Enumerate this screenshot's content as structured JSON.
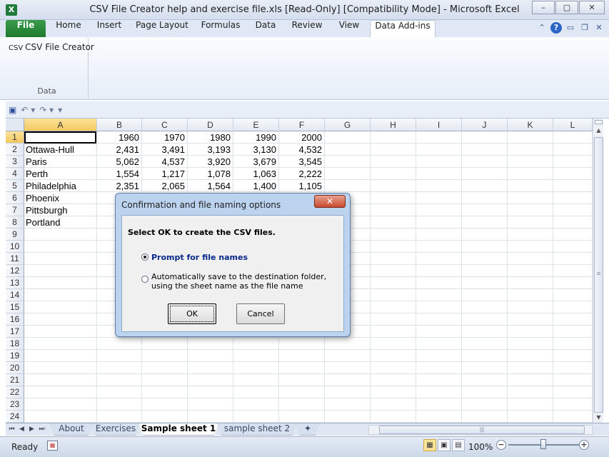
{
  "window": {
    "title": "CSV File Creator help and exercise file.xls  [Read-Only]  [Compatibility Mode]  -  Microsoft Excel",
    "app_icon": "X",
    "controls": [
      "–",
      "▢",
      "✕"
    ]
  },
  "ribbon_tabs": [
    "File",
    "Home",
    "Insert",
    "Page Layout",
    "Formulas",
    "Data",
    "Review",
    "View",
    "Data Add-ins"
  ],
  "active_tab": "Data Add-ins",
  "ribbon": {
    "csv_icon_text": "CSV",
    "csv_button_label": "CSV File Creator",
    "group_label": "Data"
  },
  "grid": {
    "columns": [
      "A",
      "B",
      "C",
      "D",
      "E",
      "F",
      "G",
      "H",
      "I",
      "J",
      "K",
      "L"
    ],
    "selected_column": "A",
    "selected_row": 1,
    "rows": [
      {
        "n": "1",
        "a": "",
        "vals": [
          "1960",
          "1970",
          "1980",
          "1990",
          "2000"
        ]
      },
      {
        "n": "2",
        "a": "Ottawa-Hull",
        "vals": [
          "2,431",
          "3,491",
          "3,193",
          "3,130",
          "4,532"
        ]
      },
      {
        "n": "3",
        "a": "Paris",
        "vals": [
          "5,062",
          "4,537",
          "3,920",
          "3,679",
          "3,545"
        ]
      },
      {
        "n": "4",
        "a": "Perth",
        "vals": [
          "1,554",
          "1,217",
          "1,078",
          "1,063",
          "2,222"
        ]
      },
      {
        "n": "5",
        "a": "Philadelphia",
        "vals": [
          "2,351",
          "2,065",
          "1,564",
          "1,400",
          "1,105"
        ]
      },
      {
        "n": "6",
        "a": "Phoenix",
        "vals": [
          "",
          "",
          "",
          "",
          ""
        ]
      },
      {
        "n": "7",
        "a": "Pittsburgh",
        "vals": [
          "",
          "",
          "",
          "",
          ""
        ]
      },
      {
        "n": "8",
        "a": "Portland",
        "vals": [
          "",
          "",
          "",
          "",
          ""
        ]
      },
      {
        "n": "9",
        "a": "",
        "vals": []
      },
      {
        "n": "10",
        "a": "",
        "vals": []
      },
      {
        "n": "11",
        "a": "",
        "vals": []
      },
      {
        "n": "12",
        "a": "",
        "vals": []
      },
      {
        "n": "13",
        "a": "",
        "vals": []
      },
      {
        "n": "14",
        "a": "",
        "vals": []
      },
      {
        "n": "15",
        "a": "",
        "vals": []
      },
      {
        "n": "16",
        "a": "",
        "vals": []
      },
      {
        "n": "17",
        "a": "",
        "vals": []
      },
      {
        "n": "18",
        "a": "",
        "vals": []
      },
      {
        "n": "19",
        "a": "",
        "vals": []
      },
      {
        "n": "20",
        "a": "",
        "vals": []
      },
      {
        "n": "21",
        "a": "",
        "vals": []
      },
      {
        "n": "22",
        "a": "",
        "vals": []
      },
      {
        "n": "23",
        "a": "",
        "vals": []
      },
      {
        "n": "24",
        "a": "",
        "vals": []
      }
    ]
  },
  "sheet_tabs": [
    "About",
    "Exercises",
    "Sample sheet 1",
    "sample sheet 2"
  ],
  "active_sheet": "Sample sheet 1",
  "status": {
    "ready": "Ready",
    "zoom": "100%",
    "zoom_fraction": 0.5
  },
  "dialog": {
    "title": "Confirmation and file naming options",
    "close": "✕",
    "message": "Select OK to create the CSV files.",
    "options": [
      {
        "label": "Prompt for file names",
        "selected": true
      },
      {
        "label": "Automatically save to the destination folder, using the sheet name as the file name",
        "selected": false
      }
    ],
    "ok": "OK",
    "cancel": "Cancel"
  },
  "colors": {
    "excel_green": "#1f7a3a",
    "selection_orange": "#f3c85f",
    "dialog_blue": "#bcd3ef"
  }
}
